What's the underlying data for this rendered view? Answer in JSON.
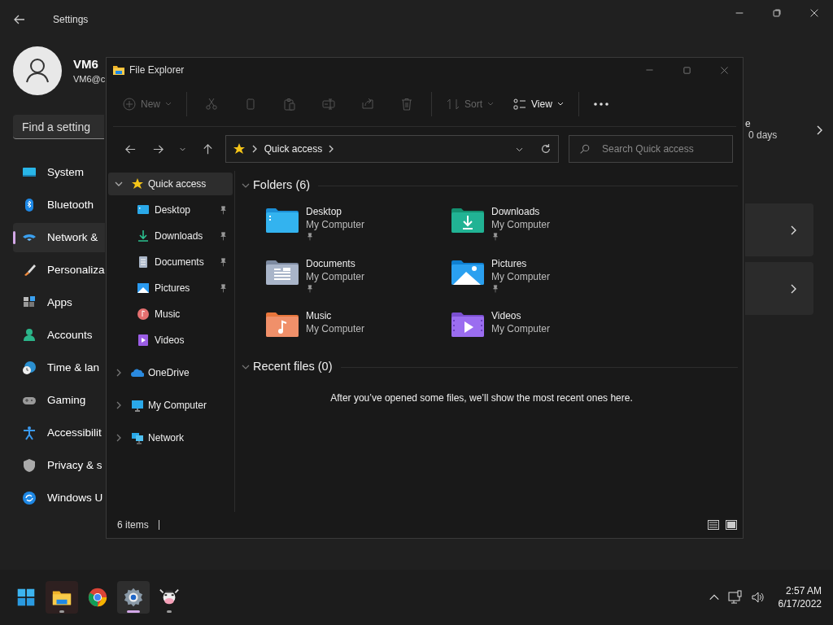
{
  "settings": {
    "title": "Settings",
    "user": {
      "name": "VM6",
      "email": "VM6@c"
    },
    "search": {
      "placeholder": "Find a setting"
    },
    "nav": [
      {
        "kind": "system",
        "label": "System",
        "selected": false
      },
      {
        "kind": "bluetooth",
        "label": "Bluetooth",
        "selected": false
      },
      {
        "kind": "network",
        "label": "Network &",
        "selected": true
      },
      {
        "kind": "personalization",
        "label": "Personaliza",
        "selected": false
      },
      {
        "kind": "apps",
        "label": "Apps",
        "selected": false
      },
      {
        "kind": "accounts",
        "label": "Accounts",
        "selected": false
      },
      {
        "kind": "time",
        "label": "Time & lan",
        "selected": false
      },
      {
        "kind": "gaming",
        "label": "Gaming",
        "selected": false
      },
      {
        "kind": "accessibility",
        "label": "Accessibilit",
        "selected": false
      },
      {
        "kind": "privacy",
        "label": "Privacy & s",
        "selected": false
      },
      {
        "kind": "update",
        "label": "Windows U",
        "selected": false
      }
    ],
    "header_card": {
      "text_1": "e",
      "text_2": "0 days"
    }
  },
  "explorer": {
    "title": "File Explorer",
    "toolbar": [
      [
        {
          "kind": "new",
          "label": "New",
          "disabled": true
        }
      ],
      [
        {
          "kind": "cut",
          "disabled": true
        },
        {
          "kind": "copy",
          "disabled": true
        },
        {
          "kind": "paste",
          "disabled": true
        },
        {
          "kind": "rename",
          "disabled": true
        },
        {
          "kind": "share",
          "disabled": true
        },
        {
          "kind": "delete",
          "disabled": true
        }
      ],
      [
        {
          "kind": "sort",
          "label": "Sort",
          "disabled": true
        },
        {
          "kind": "view",
          "label": "View",
          "disabled": false
        }
      ],
      [
        {
          "kind": "more",
          "disabled": false
        }
      ]
    ],
    "address": {
      "path": "Quick access"
    },
    "search": {
      "placeholder": "Search Quick access"
    },
    "nav": [
      {
        "kind": "quick",
        "label": "Quick access",
        "selected": true,
        "expanded": true,
        "children": [
          {
            "kind": "desktop",
            "label": "Desktop",
            "pinned": true
          },
          {
            "kind": "downloads",
            "label": "Downloads",
            "pinned": true
          },
          {
            "kind": "documents",
            "label": "Documents",
            "pinned": true
          },
          {
            "kind": "pictures",
            "label": "Pictures",
            "pinned": true
          },
          {
            "kind": "music",
            "label": "Music",
            "pinned": false
          },
          {
            "kind": "videos",
            "label": "Videos",
            "pinned": false
          }
        ]
      },
      {
        "kind": "onedrive",
        "label": "OneDrive",
        "selected": false,
        "expanded": false
      },
      {
        "kind": "computer",
        "label": "My Computer",
        "selected": false,
        "expanded": false
      },
      {
        "kind": "network",
        "label": "Network",
        "selected": false,
        "expanded": false
      }
    ],
    "folders_header": "Folders (6)",
    "folders": [
      {
        "kind": "desktop",
        "name": "Desktop",
        "location": "My Computer",
        "pinned": true
      },
      {
        "kind": "downloads",
        "name": "Downloads",
        "location": "My Computer",
        "pinned": true
      },
      {
        "kind": "documents",
        "name": "Documents",
        "location": "My Computer",
        "pinned": true
      },
      {
        "kind": "pictures",
        "name": "Pictures",
        "location": "My Computer",
        "pinned": true
      },
      {
        "kind": "music",
        "name": "Music",
        "location": "My Computer",
        "pinned": false
      },
      {
        "kind": "videos",
        "name": "Videos",
        "location": "My Computer",
        "pinned": false
      }
    ],
    "recent_header": "Recent files (0)",
    "recent_message": "After you’ve opened some files, we’ll show the most recent ones here.",
    "status": "6 items"
  },
  "taskbar": {
    "apps": [
      {
        "kind": "start",
        "highlighted": false,
        "running": false,
        "selected": false
      },
      {
        "kind": "explorer",
        "highlighted": true,
        "running": true,
        "selected": false
      },
      {
        "kind": "chrome",
        "highlighted": false,
        "running": false,
        "selected": false
      },
      {
        "kind": "settings",
        "highlighted": true,
        "running": true,
        "selected": true
      },
      {
        "kind": "cow",
        "highlighted": false,
        "running": true,
        "selected": false
      }
    ],
    "time": "2:57 AM",
    "date": "6/17/2022"
  }
}
